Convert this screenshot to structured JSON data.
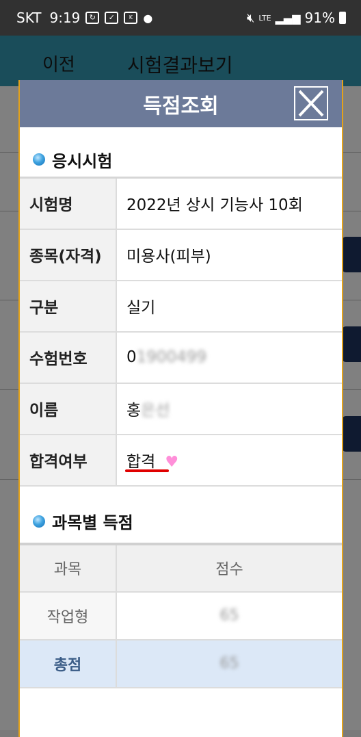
{
  "status_bar": {
    "carrier": "SKT",
    "time": "9:19",
    "battery": "91%",
    "network": "LTE"
  },
  "background_app": {
    "back_label": "이전",
    "title": "시험결과보기"
  },
  "modal": {
    "title": "득점조회",
    "exam_section_title": "응시시험",
    "exam_rows": [
      {
        "label": "시험명",
        "value": "2022년 상시 기능사 10회"
      },
      {
        "label": "종목(자격)",
        "value": "미용사(피부)"
      },
      {
        "label": "구분",
        "value": "실기"
      },
      {
        "label": "수험번호",
        "value": "0",
        "masked": "1900499"
      },
      {
        "label": "이름",
        "value": "홍",
        "masked": "은선"
      },
      {
        "label": "합격여부",
        "value": "합격"
      }
    ],
    "score_section_title": "과목별 득점",
    "score_table": {
      "headers": [
        "과목",
        "점수"
      ],
      "rows": [
        {
          "subject": "작업형",
          "score": "65"
        }
      ],
      "total": {
        "label": "총점",
        "score": "65"
      }
    }
  }
}
